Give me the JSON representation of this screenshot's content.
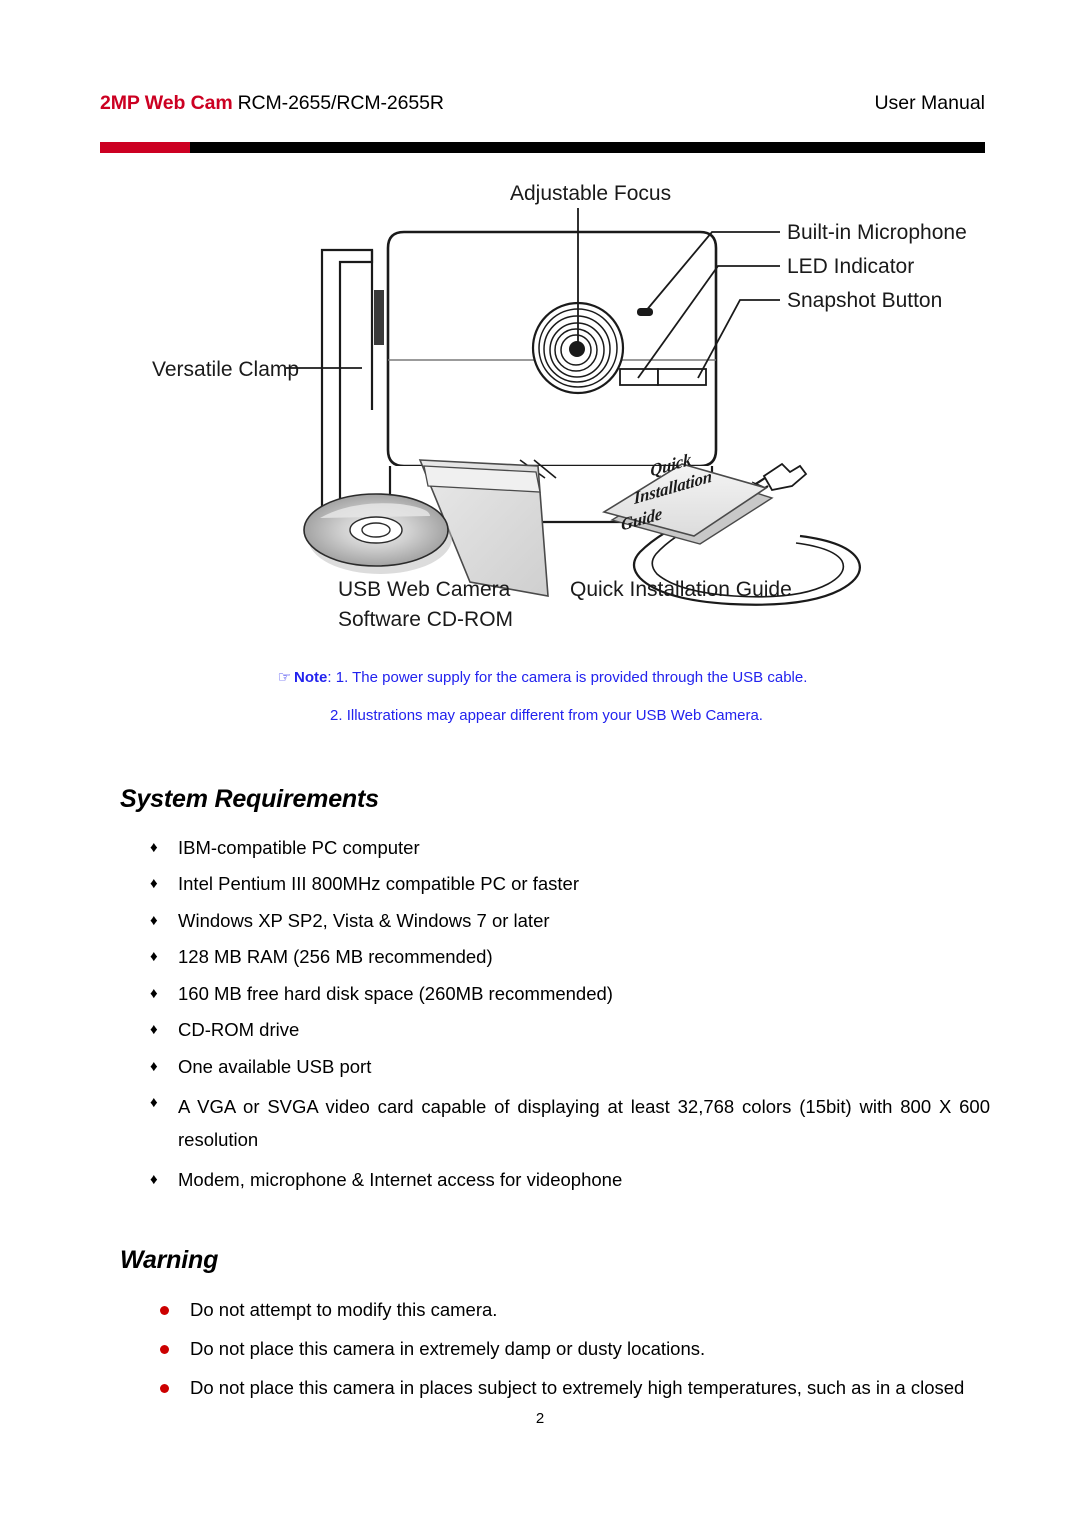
{
  "header": {
    "brand": "2MP Web Cam",
    "model": "RCM-2655/RCM-2655R",
    "doc_type": "User Manual",
    "accent_red": "#cc0022"
  },
  "figure": {
    "callouts": {
      "adjustable_focus": "Adjustable Focus",
      "built_in_microphone": "Built-in Microphone",
      "led_indicator": "LED Indicator",
      "snapshot_button": "Snapshot Button",
      "versatile_clamp": "Versatile Clamp"
    },
    "accessories": {
      "cd_line1": "USB Web Camera",
      "cd_line2": "Software CD-ROM",
      "guide": "Quick Installation Guide",
      "guide_cover_line1": "Quick",
      "guide_cover_line2": "Installation",
      "guide_cover_line3": "Guide"
    }
  },
  "note": {
    "hand_icon": "☞",
    "label": "Note",
    "item1": ": 1. The power supply for the camera is provided through the USB cable.",
    "item2": "2. Illustrations may appear different from your USB Web Camera.",
    "color": "#2222ee"
  },
  "system_requirements": {
    "heading": "System Requirements",
    "bullet_glyph": "♦",
    "items": [
      "IBM-compatible PC computer",
      "Intel Pentium III 800MHz compatible PC or faster",
      "Windows XP SP2, Vista & Windows 7 or later",
      "128 MB RAM (256 MB recommended)",
      "160 MB free hard disk space (260MB recommended)",
      "CD-ROM drive",
      "One available USB port",
      "A VGA or SVGA video card capable of displaying at least 32,768 colors (15bit) with 800 X 600 resolution",
      "Modem, microphone & Internet access for videophone"
    ]
  },
  "warning": {
    "heading": "Warning",
    "bullet_color": "#cc0000",
    "items": [
      "Do not attempt to modify this camera.",
      "Do not place this camera in extremely damp or dusty locations.",
      "Do not place this camera in places subject to extremely high temperatures, such as in a closed"
    ]
  },
  "footer": {
    "page_number": "2"
  }
}
